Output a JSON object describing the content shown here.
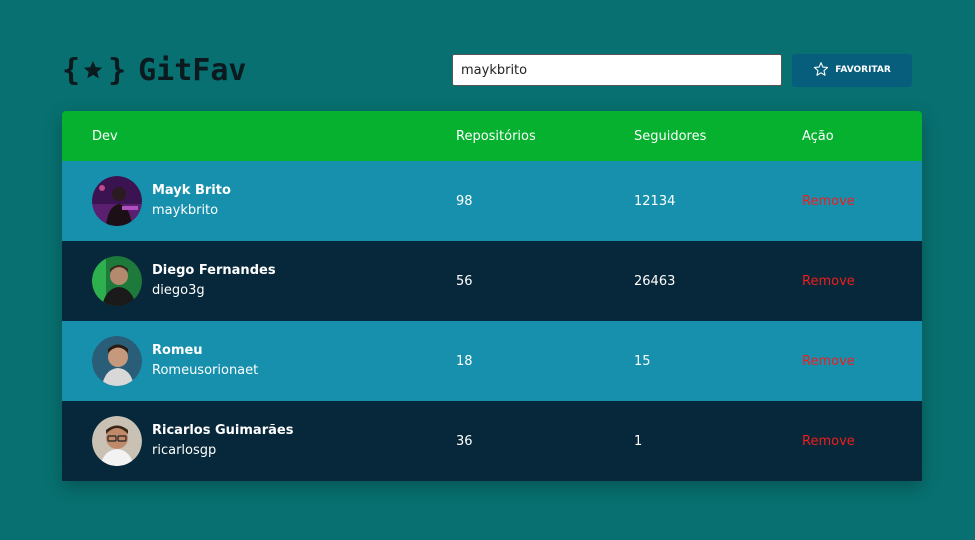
{
  "app": {
    "logo_text": "GitFav",
    "logo_icon": "braces-star-icon"
  },
  "search": {
    "value": "maykbrito",
    "button_label": "FAVORITAR",
    "button_icon": "star-outline-icon"
  },
  "table": {
    "headers": {
      "dev": "Dev",
      "repos": "Repositórios",
      "followers": "Seguidores",
      "action": "Ação"
    },
    "rows": [
      {
        "name": "Mayk Brito",
        "login": "maykbrito",
        "repos": "98",
        "followers": "12134",
        "action": "Remove"
      },
      {
        "name": "Diego Fernandes",
        "login": "diego3g",
        "repos": "56",
        "followers": "26463",
        "action": "Remove"
      },
      {
        "name": "Romeu",
        "login": "Romeusorionaet",
        "repos": "18",
        "followers": "15",
        "action": "Remove"
      },
      {
        "name": "Ricarlos Guimarães",
        "login": "ricarlosgp",
        "repos": "36",
        "followers": "1",
        "action": "Remove"
      }
    ]
  },
  "colors": {
    "background": "#087070",
    "header_green": "#05b12e",
    "row_light": "#1790ad",
    "row_dark": "#07283a",
    "remove_red": "#f21c1c",
    "button_blue": "#065e7c"
  }
}
